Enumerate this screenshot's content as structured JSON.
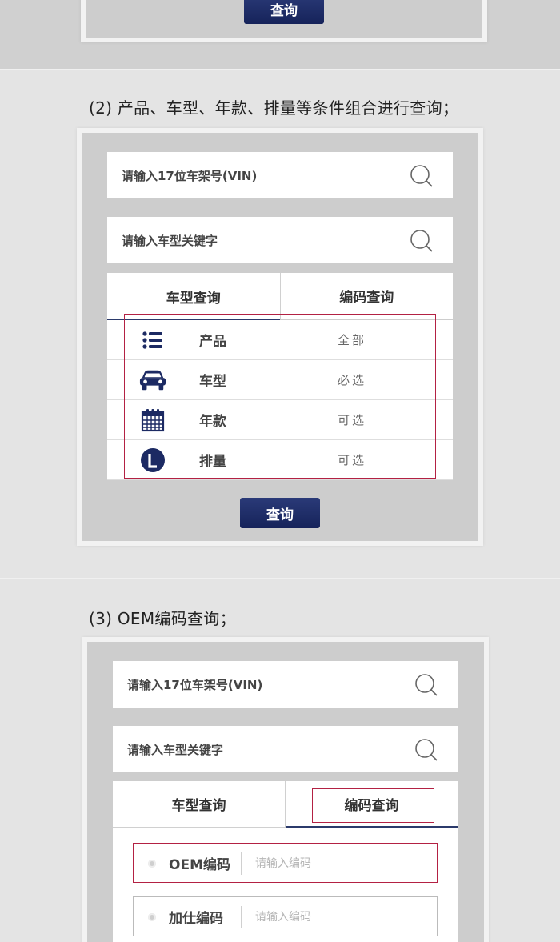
{
  "section1": {
    "query_button": "查询"
  },
  "section2": {
    "caption": "(2) 产品、车型、年款、排量等条件组合进行查询；",
    "vin_placeholder": "请输入17位车架号(VIN)",
    "keyword_placeholder": "请输入车型关键字",
    "tabs": [
      "车型查询",
      "编码查询"
    ],
    "rows": [
      {
        "icon": "list-icon",
        "label": "产品",
        "value": "全部"
      },
      {
        "icon": "car-icon",
        "label": "车型",
        "value": "必选"
      },
      {
        "icon": "calendar-icon",
        "label": "年款",
        "value": "可选"
      },
      {
        "icon": "displacement-L-icon",
        "label": "排量",
        "value": "可选"
      }
    ],
    "query_button": "查询"
  },
  "section3": {
    "caption": "(3) OEM编码查询；",
    "vin_placeholder": "请输入17位车架号(VIN)",
    "keyword_placeholder": "请输入车型关键字",
    "tabs": [
      "车型查询",
      "编码查询"
    ],
    "code_rows": [
      {
        "label": "OEM编码",
        "placeholder": "请输入编码"
      },
      {
        "label": "加仕编码",
        "placeholder": "请输入编码"
      }
    ]
  },
  "colors": {
    "navy": "#1c2a63",
    "highlight_red": "#b32143",
    "panel_gray": "#cdcdcd"
  }
}
